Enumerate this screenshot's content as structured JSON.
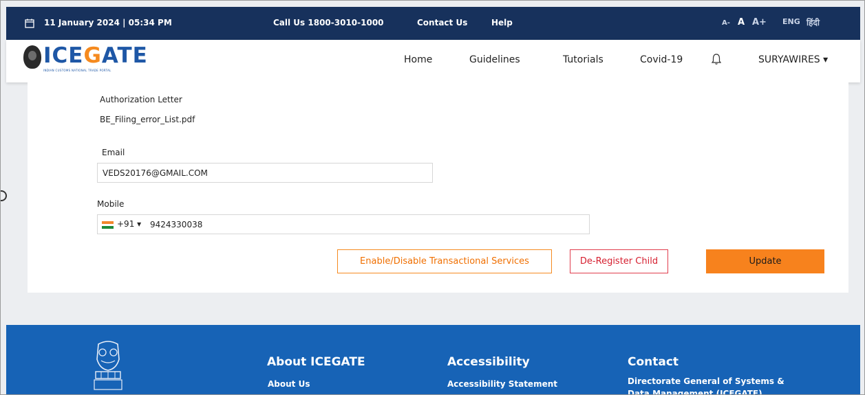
{
  "topbar": {
    "date": "11 January 2024 | 05:34 PM",
    "call": "Call Us  1800-3010-1000",
    "contact": "Contact Us",
    "help": "Help",
    "font_small": "A-",
    "font_medium": "A",
    "font_large": "A+",
    "lang_en": "ENG",
    "lang_hi": "हिंदी"
  },
  "nav": {
    "logo_a": "ICE",
    "logo_b": "G",
    "logo_c": "ATE",
    "logo_tag": "INDIAN CUSTOMS NATIONAL TRADE PORTAL",
    "home": "Home",
    "guidelines": "Guidelines",
    "tutorials": "Tutorials",
    "covid": "Covid-19",
    "user": "SURYAWIRES ▾"
  },
  "form": {
    "auth_label": "Authorization Letter",
    "auth_file": "BE_Filing_error_List.pdf",
    "email_label": "Email",
    "email_value": "VEDS20176@GMAIL.COM",
    "mobile_label": "Mobile",
    "dial_code": "+91 ▾",
    "mobile_value": "9424330038",
    "btn_enable": "Enable/Disable Transactional Services",
    "btn_deregister": "De-Register Child",
    "btn_update": "Update"
  },
  "footer": {
    "about_heading": "About ICEGATE",
    "about_link": "About Us",
    "access_heading": "Accessibility",
    "access_link": "Accessibility Statement",
    "contact_heading": "Contact",
    "contact_line1": "Directorate General of Systems &",
    "contact_line2": "Data Management (ICEGATE)"
  },
  "colors": {
    "topbar": "#17315c",
    "footer": "#1763b6",
    "accent_orange": "#f7821d",
    "deregister_red": "#d62030"
  },
  "icons": [
    "calendar-icon",
    "bell-icon",
    "india-flag-icon",
    "national-emblem-icon"
  ]
}
